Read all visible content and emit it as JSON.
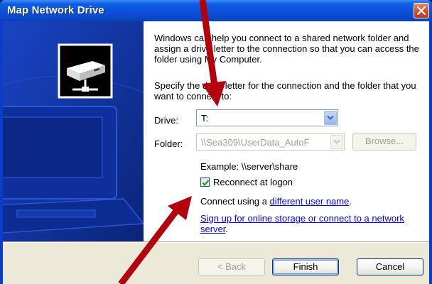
{
  "window": {
    "title": "Map Network Drive"
  },
  "content": {
    "intro": "Windows can help you connect to a shared network folder and assign a drive letter to the connection so that you can access the folder using My Computer.",
    "specify": "Specify the drive letter for the connection and the folder that you want to connect to:",
    "drive_label": "Drive:",
    "drive_value": "T:",
    "folder_label": "Folder:",
    "folder_value": "\\\\Sea309\\UserData_AutoF",
    "browse_label": "Browse...",
    "example": "Example: \\\\server\\share",
    "reconnect_label": "Reconnect at logon",
    "reconnect_checked": true,
    "connect_using_prefix": "Connect using a ",
    "connect_using_link": "different user name",
    "connect_using_suffix": ".",
    "signup_link": "Sign up for online storage or connect to a network server",
    "signup_suffix": "."
  },
  "footer": {
    "back_label": "< Back",
    "finish_label": "Finish",
    "cancel_label": "Cancel"
  },
  "colors": {
    "title_bar": "#0a50d8",
    "banner": "#0c2c98",
    "annotation_arrow": "#b3000c",
    "link": "#0000ff"
  },
  "icons": [
    "close-icon",
    "network-drive-icon",
    "dropdown-arrow-icon",
    "checkmark-icon"
  ]
}
